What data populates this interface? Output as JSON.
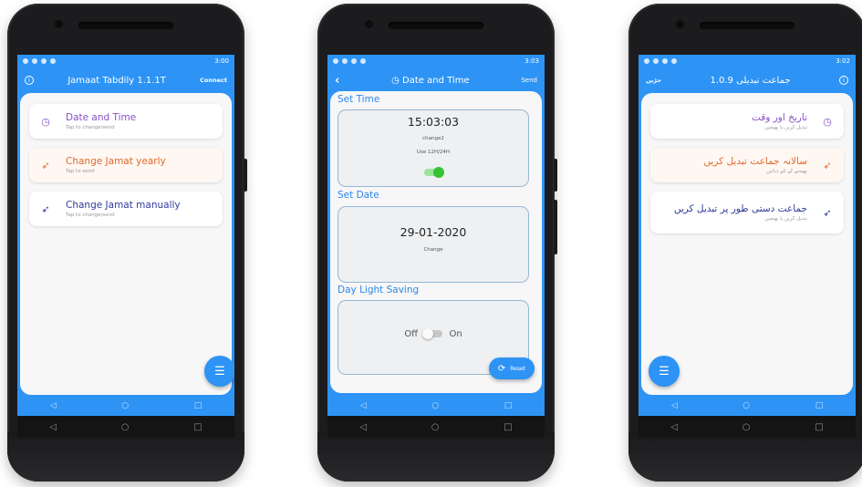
{
  "statusbar": {
    "phone1_time": "3:00",
    "phone2_time": "3:03",
    "phone3_time": "3:02"
  },
  "phone1": {
    "title": "Jamaat Tabdily 1.1.1T",
    "connect_label": "Connect",
    "items": [
      {
        "label": "Date and Time",
        "sub": "Tap to change/send",
        "icon": "clock-icon",
        "color": "#8a4fc6"
      },
      {
        "label": "Change Jamat yearly",
        "sub": "Tap to send",
        "icon": "paper-plane-icon",
        "color": "#e06a2c"
      },
      {
        "label": "Change Jamat manually",
        "sub": "Tap to change/send",
        "icon": "paper-plane-icon",
        "color": "#2e3a9a"
      }
    ]
  },
  "phone2": {
    "title": "Date and Time",
    "send_label": "Send",
    "set_time_label": "Set Time",
    "time_value": "15:03:03",
    "change2_label": "change2",
    "format_label": "Use 12H/24H",
    "set_date_label": "Set Date",
    "date_value": "29-01-2020",
    "change_label": "Change",
    "dst_label": "Day Light Saving",
    "off_label": "Off",
    "on_label": "On",
    "reset_label": "Reset"
  },
  "phone3": {
    "title": "جماعت تبدیلی 1.0.9",
    "connect_label": "جڑیں",
    "items": [
      {
        "label": "تاریخ اور وقت",
        "sub": "تبدیل کریں یا بھیجیں",
        "icon": "clock-icon",
        "color": "#8a4fc6"
      },
      {
        "label": "سالانہ جماعت تبدیل کریں",
        "sub": "بھیجنے کے لئے دبائیں",
        "icon": "paper-plane-icon",
        "color": "#e06a2c"
      },
      {
        "label": "جماعت دستی طور پر تبدیل کریں",
        "sub": "تبدیل کریں یا بھیجیں",
        "icon": "paper-plane-icon",
        "color": "#2e3a9a"
      }
    ]
  },
  "nav": {
    "back": "◁",
    "home": "○",
    "recent": "□"
  },
  "colors": {
    "accent": "#2d93f5",
    "time": "#8a4fc6",
    "yearly": "#e06a2c",
    "manual": "#2e3a9a"
  }
}
